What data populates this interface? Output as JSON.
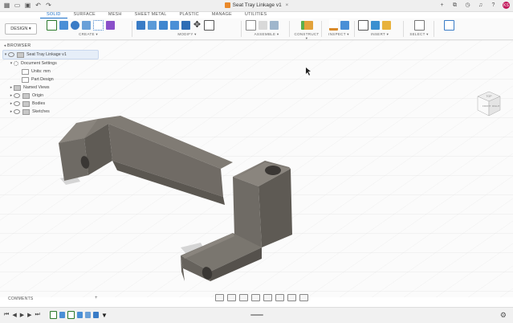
{
  "titlebar": {
    "title": "Seat Tray Linkage v1",
    "avatar_initials": "KS"
  },
  "tabs": [
    {
      "label": "SOLID",
      "active": true
    },
    {
      "label": "SURFACE",
      "active": false
    },
    {
      "label": "MESH",
      "active": false
    },
    {
      "label": "SHEET METAL",
      "active": false
    },
    {
      "label": "PLASTIC",
      "active": false
    },
    {
      "label": "MANAGE",
      "active": false
    },
    {
      "label": "UTILITIES",
      "active": false
    }
  ],
  "ribbon": {
    "workspace": "DESIGN ▾",
    "groups": [
      {
        "label": "CREATE ▾"
      },
      {
        "label": "MODIFY ▾"
      },
      {
        "label": "ASSEMBLE ▾"
      },
      {
        "label": "CONSTRUCT ▾"
      },
      {
        "label": "INSPECT ▾"
      },
      {
        "label": "INSERT ▾"
      },
      {
        "label": "SELECT ▾"
      }
    ]
  },
  "browser": {
    "header": "BROWSER",
    "root": "Seat Tray Linkage v1",
    "items": [
      {
        "label": "Document Settings",
        "level": 1
      },
      {
        "label": "Units: mm",
        "level": 2
      },
      {
        "label": "Part Design",
        "level": 2
      },
      {
        "label": "Named Views",
        "level": 1
      },
      {
        "label": "Origin",
        "level": 1
      },
      {
        "label": "Bodies",
        "level": 1
      },
      {
        "label": "Sketches",
        "level": 1
      }
    ]
  },
  "viewcube": {
    "top_label": "TOP",
    "front_label": "FRONT",
    "right_label": "RIGHT"
  },
  "comments": {
    "label": "COMMENTS"
  },
  "colors": {
    "accent": "#1a6fc9",
    "model_light": "#76716a",
    "model_dark": "#5a5650"
  },
  "icons": [
    "back-arrow-icon",
    "grid-icon",
    "file-icon",
    "save-icon",
    "undo-icon",
    "redo-icon",
    "close-icon",
    "add-tab-icon",
    "extension-icon",
    "clock-icon",
    "bell-icon",
    "help-icon"
  ]
}
